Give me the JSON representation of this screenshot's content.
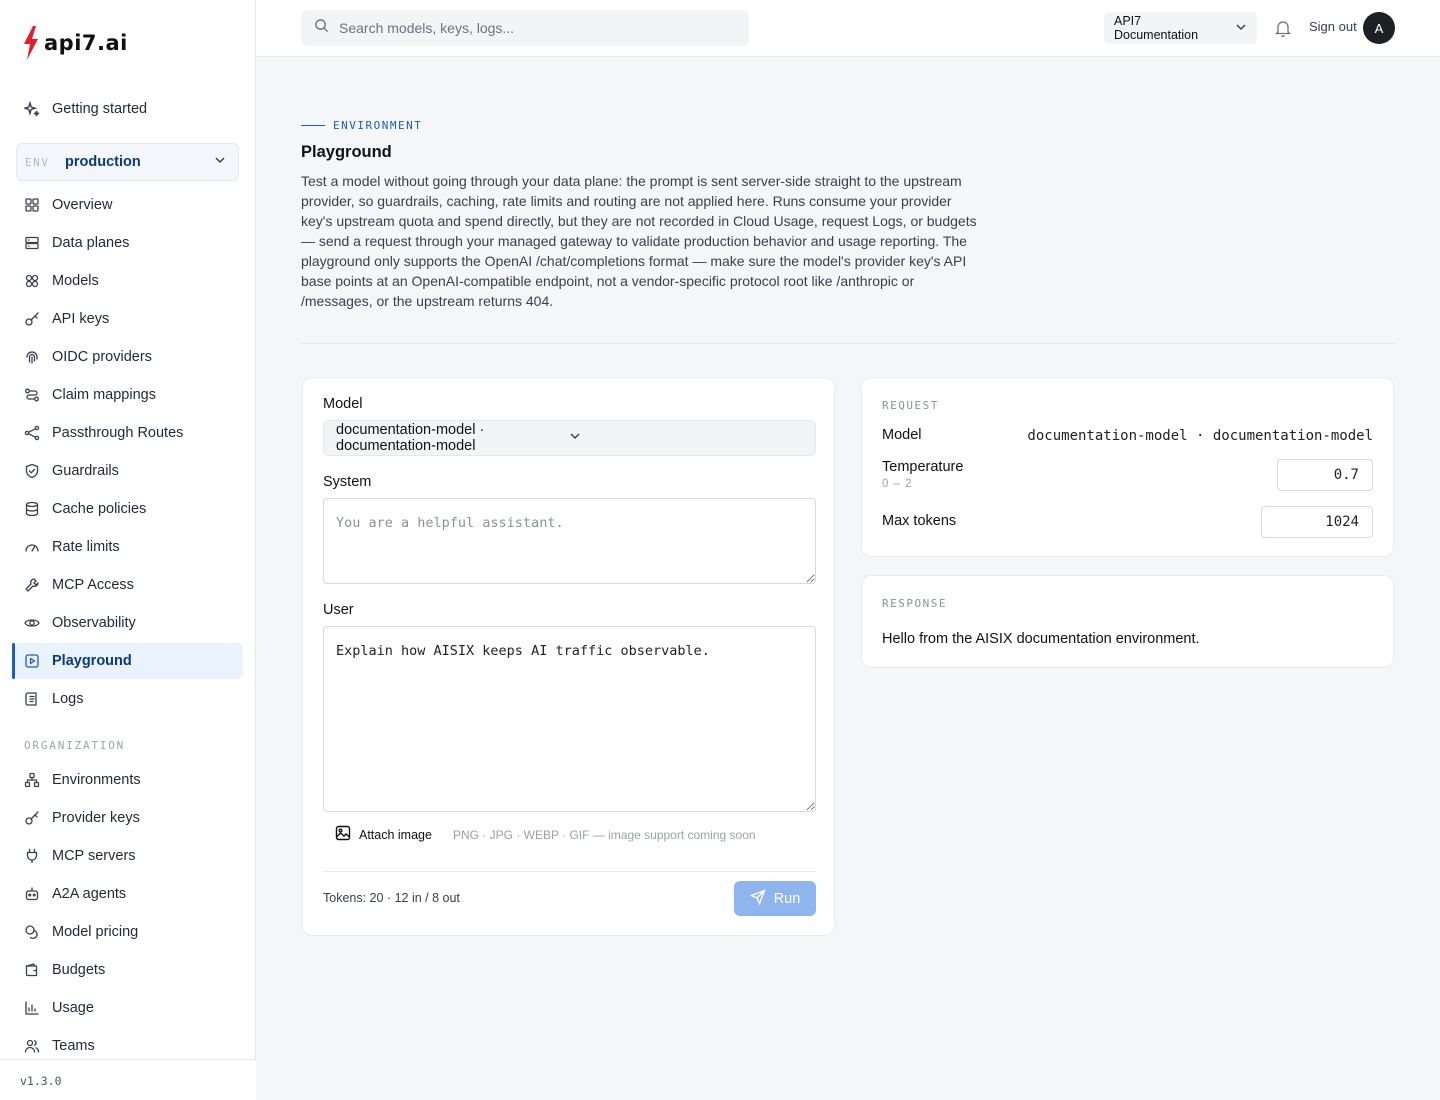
{
  "brand": {
    "name": "api7.ai"
  },
  "sidebar": {
    "getting_started": "Getting started",
    "env": {
      "tag": "ENV",
      "value": "production"
    },
    "items": [
      {
        "label": "Overview",
        "icon": "grid-icon"
      },
      {
        "label": "Data planes",
        "icon": "server-icon"
      },
      {
        "label": "Models",
        "icon": "cubes-icon"
      },
      {
        "label": "API keys",
        "icon": "key-icon"
      },
      {
        "label": "OIDC providers",
        "icon": "fingerprint-icon"
      },
      {
        "label": "Claim mappings",
        "icon": "mapping-icon"
      },
      {
        "label": "Passthrough Routes",
        "icon": "route-icon"
      },
      {
        "label": "Guardrails",
        "icon": "shield-icon"
      },
      {
        "label": "Cache policies",
        "icon": "database-icon"
      },
      {
        "label": "Rate limits",
        "icon": "gauge-icon"
      },
      {
        "label": "MCP Access",
        "icon": "wrench-icon"
      },
      {
        "label": "Observability",
        "icon": "eye-icon"
      },
      {
        "label": "Playground",
        "icon": "play-icon",
        "active": true
      },
      {
        "label": "Logs",
        "icon": "logs-icon"
      }
    ],
    "org_label": "ORGANIZATION",
    "org_items": [
      {
        "label": "Environments",
        "icon": "network-icon"
      },
      {
        "label": "Provider keys",
        "icon": "key-icon"
      },
      {
        "label": "MCP servers",
        "icon": "plug-icon"
      },
      {
        "label": "A2A agents",
        "icon": "bot-icon"
      },
      {
        "label": "Model pricing",
        "icon": "coins-icon"
      },
      {
        "label": "Budgets",
        "icon": "wallet-icon"
      },
      {
        "label": "Usage",
        "icon": "chart-icon"
      },
      {
        "label": "Teams",
        "icon": "users-icon"
      }
    ],
    "version": "v1.3.0"
  },
  "topbar": {
    "search_placeholder": "Search models, keys, logs...",
    "org_selector": "API7 Documentation",
    "sign_out": "Sign out",
    "avatar_initial": "A"
  },
  "header": {
    "eyebrow": "ENVIRONMENT",
    "title": "Playground",
    "description": "Test a model without going through your data plane: the prompt is sent server-side straight to the upstream provider, so guardrails, caching, rate limits and routing are not applied here. Runs consume your provider key's upstream quota and spend directly, but they are not recorded in Cloud Usage, request Logs, or budgets — send a request through your managed gateway to validate production behavior and usage reporting. The playground only supports the OpenAI /chat/completions format — make sure the model's provider key's API base points at an OpenAI-compatible endpoint, not a vendor-specific protocol root like /anthropic or /messages, or the upstream returns 404."
  },
  "form": {
    "model_label": "Model",
    "model_value": "documentation-model · documentation-model",
    "system_label": "System",
    "system_placeholder": "You are a helpful assistant.",
    "user_label": "User",
    "user_value": "Explain how AISIX keeps AI traffic observable.",
    "attach_label": "Attach image",
    "attach_hint": "PNG · JPG · WEBP · GIF — image support coming soon",
    "tokens": "Tokens: 20 · 12 in / 8 out",
    "run_label": "Run"
  },
  "request": {
    "section": "REQUEST",
    "model_label": "Model",
    "model_value": "documentation-model · documentation-model",
    "temperature_label": "Temperature",
    "temperature_range": "0 – 2",
    "temperature_value": "0.7",
    "max_tokens_label": "Max tokens",
    "max_tokens_value": "1024"
  },
  "response": {
    "section": "RESPONSE",
    "text": "Hello from the AISIX documentation environment."
  },
  "colors": {
    "accent": "#1d5bbf",
    "run_button": "#8fb5ee",
    "active_bg": "#eaf2fd"
  }
}
